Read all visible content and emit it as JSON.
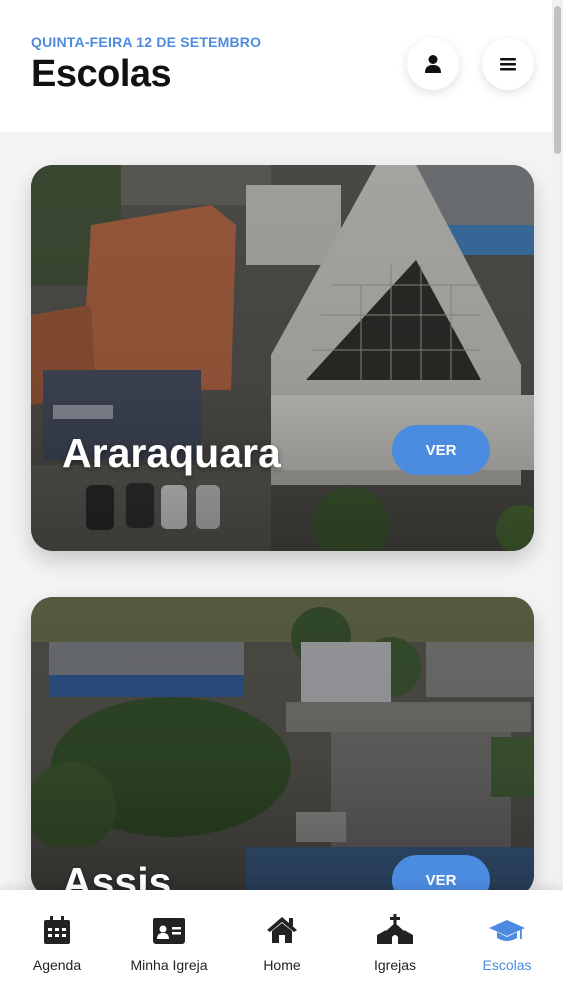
{
  "header": {
    "date": "QUINTA-FEIRA 12 DE SETEMBRO",
    "title": "Escolas",
    "profile_icon": "user-icon",
    "menu_icon": "hamburger-menu-icon"
  },
  "schools": [
    {
      "name": "Araraquara",
      "action_label": "VER"
    },
    {
      "name": "Assis",
      "action_label": "VER"
    }
  ],
  "nav": {
    "items": [
      {
        "label": "Agenda",
        "icon": "calendar-icon"
      },
      {
        "label": "Minha Igreja",
        "icon": "id-card-icon"
      },
      {
        "label": "Home",
        "icon": "home-icon"
      },
      {
        "label": "Igrejas",
        "icon": "church-icon"
      },
      {
        "label": "Escolas",
        "icon": "graduation-cap-icon"
      }
    ],
    "active": "Escolas"
  },
  "colors": {
    "accent": "#4c8ce0",
    "text": "#111111",
    "background": "#f4f4f4"
  }
}
